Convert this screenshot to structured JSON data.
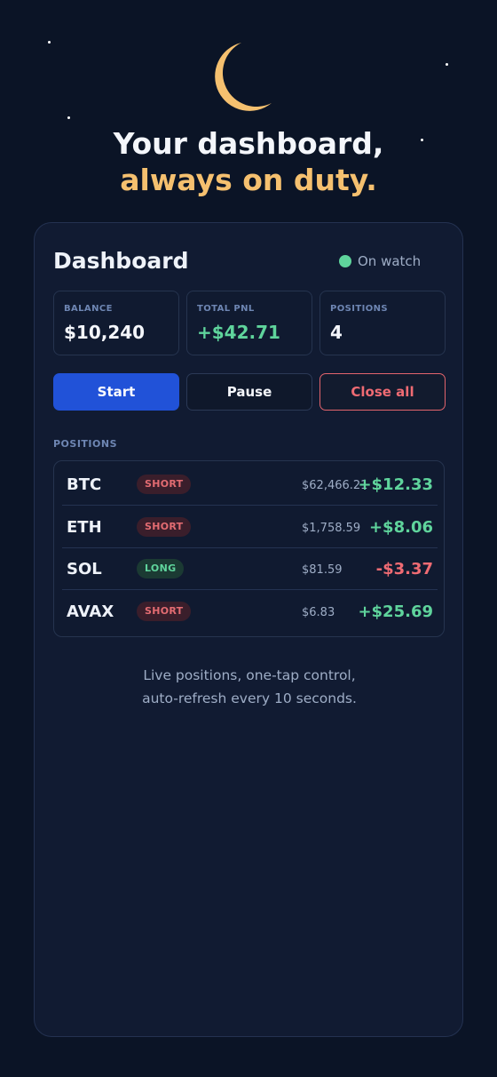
{
  "hero": {
    "line1": "Your dashboard,",
    "line2": "always on duty."
  },
  "icons": {
    "moon": "crescent-moon-icon",
    "status": "status-dot"
  },
  "colors": {
    "background": "#0b1426",
    "card": "#111b32",
    "accent_gold": "#f5c06f",
    "primary": "#2152d8",
    "positive": "#5fd49c",
    "negative": "#ef6b73"
  },
  "dashboard": {
    "title": "Dashboard",
    "status": "On watch",
    "stats": [
      {
        "label": "BALANCE",
        "value": "$10,240"
      },
      {
        "label": "TOTAL PNL",
        "value": "+$42.71"
      },
      {
        "label": "POSITIONS",
        "value": "4"
      }
    ],
    "buttons": {
      "start": "Start",
      "pause": "Pause",
      "close_all": "Close all"
    },
    "positions_label": "POSITIONS",
    "positions": [
      {
        "symbol": "BTC",
        "side": "SHORT",
        "price": "$62,466.21",
        "pnl": "+$12.33"
      },
      {
        "symbol": "ETH",
        "side": "SHORT",
        "price": "$1,758.59",
        "pnl": "+$8.06"
      },
      {
        "symbol": "SOL",
        "side": "LONG",
        "price": "$81.59",
        "pnl": "-$3.37"
      },
      {
        "symbol": "AVAX",
        "side": "SHORT",
        "price": "$6.83",
        "pnl": "+$25.69"
      }
    ],
    "footer_line1": "Live positions, one-tap control,",
    "footer_line2": "auto-refresh every 10 seconds."
  }
}
